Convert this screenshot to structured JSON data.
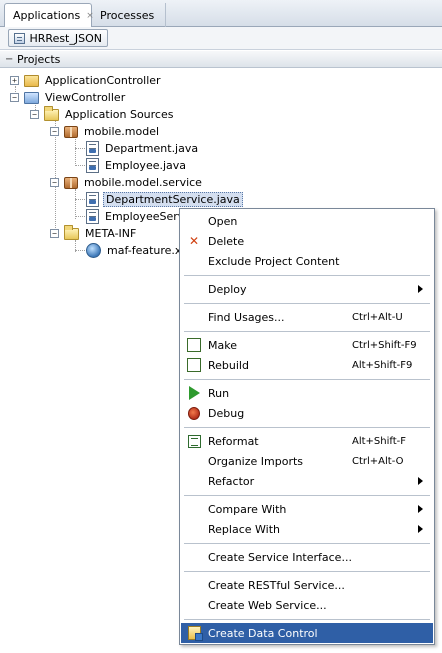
{
  "tabs": {
    "applications": "Applications",
    "applications_close": "×",
    "processes": "Processes"
  },
  "toolbar": {
    "app_name": "HRRest_JSON"
  },
  "projects_header": {
    "collapse_glyph": "−",
    "title": "Projects"
  },
  "tree": {
    "application_controller": "ApplicationController",
    "view_controller": "ViewController",
    "application_sources": "Application Sources",
    "mobile_model": "mobile.model",
    "department_java": "Department.java",
    "employee_java": "Employee.java",
    "mobile_model_service": "mobile.model.service",
    "department_service_java": "DepartmentService.java",
    "employee_service_java": "EmployeeServic",
    "meta_inf": "META-INF",
    "maf_feature_xml": "maf-feature.xm",
    "expand_plus": "+",
    "expand_minus": "−"
  },
  "context_menu": {
    "open": "Open",
    "delete": "Delete",
    "exclude_project_content": "Exclude Project Content",
    "deploy": "Deploy",
    "find_usages": "Find Usages...",
    "find_usages_shortcut": "Ctrl+Alt-U",
    "make": "Make",
    "make_shortcut": "Ctrl+Shift-F9",
    "rebuild": "Rebuild",
    "rebuild_shortcut": "Alt+Shift-F9",
    "run": "Run",
    "debug": "Debug",
    "reformat": "Reformat",
    "reformat_shortcut": "Alt+Shift-F",
    "organize_imports": "Organize Imports",
    "organize_imports_shortcut": "Ctrl+Alt-O",
    "refactor": "Refactor",
    "compare_with": "Compare With",
    "replace_with": "Replace With",
    "create_service_interface": "Create Service Interface...",
    "create_restful_service": "Create RESTful Service...",
    "create_web_service": "Create Web Service...",
    "create_data_control": "Create Data Control",
    "delete_glyph": "✕"
  },
  "colors": {
    "menu_highlight": "#2f5fa6",
    "selection_background": "#d4dff0"
  }
}
